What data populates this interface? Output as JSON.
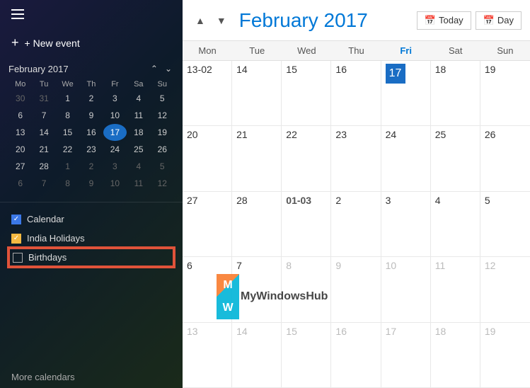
{
  "sidebar": {
    "new_event_label": "+ New event",
    "mini_cal_title": "February 2017",
    "day_headers": [
      "Mo",
      "Tu",
      "We",
      "Th",
      "Fr",
      "Sa",
      "Su"
    ],
    "weeks": [
      [
        "30",
        "31",
        "1",
        "2",
        "3",
        "4",
        "5"
      ],
      [
        "6",
        "7",
        "8",
        "9",
        "10",
        "11",
        "12"
      ],
      [
        "13",
        "14",
        "15",
        "16",
        "17",
        "18",
        "19"
      ],
      [
        "20",
        "21",
        "22",
        "23",
        "24",
        "25",
        "26"
      ],
      [
        "27",
        "28",
        "1",
        "2",
        "3",
        "4",
        "5"
      ],
      [
        "6",
        "7",
        "8",
        "9",
        "10",
        "11",
        "12"
      ]
    ],
    "week_other": [
      [
        true,
        true,
        false,
        false,
        false,
        false,
        false
      ],
      [
        false,
        false,
        false,
        false,
        false,
        false,
        false
      ],
      [
        false,
        false,
        false,
        false,
        false,
        false,
        false
      ],
      [
        false,
        false,
        false,
        false,
        false,
        false,
        false
      ],
      [
        false,
        false,
        true,
        true,
        true,
        true,
        true
      ],
      [
        true,
        true,
        true,
        true,
        true,
        true,
        true
      ]
    ],
    "today_cell": [
      2,
      4
    ],
    "calendars": [
      {
        "label": "Calendar",
        "checked": true,
        "type": "blue"
      },
      {
        "label": "India Holidays",
        "checked": true,
        "type": "yellow"
      },
      {
        "label": "Birthdays",
        "checked": false,
        "type": "none",
        "highlighted": true
      }
    ],
    "more_calendars_label": "More calendars"
  },
  "header": {
    "title": "February 2017",
    "today_label": "Today",
    "day_label": "Day",
    "nav_up": "▲",
    "nav_down": "▼"
  },
  "cal_grid": {
    "day_headers": [
      "Mon",
      "Tue",
      "Wed",
      "Thu",
      "Fri",
      "Sat",
      "Sun"
    ],
    "weeks": [
      [
        "13-02",
        "14",
        "15",
        "16",
        "17",
        "18",
        "19"
      ],
      [
        "20",
        "21",
        "22",
        "23",
        "24",
        "25",
        "26"
      ],
      [
        "27",
        "28",
        "01-03",
        "2",
        "3",
        "4",
        "5"
      ],
      [
        "6",
        "7",
        "8",
        "9",
        "10",
        "11",
        "12"
      ],
      [
        "13",
        "14",
        "15",
        "16",
        "17",
        "18",
        "19"
      ]
    ],
    "today_idx": [
      0,
      4
    ],
    "selected_range": [
      2,
      2
    ]
  },
  "watermark": {
    "letter1": "M",
    "letter2": "W",
    "text": "MyWindowsHub"
  }
}
